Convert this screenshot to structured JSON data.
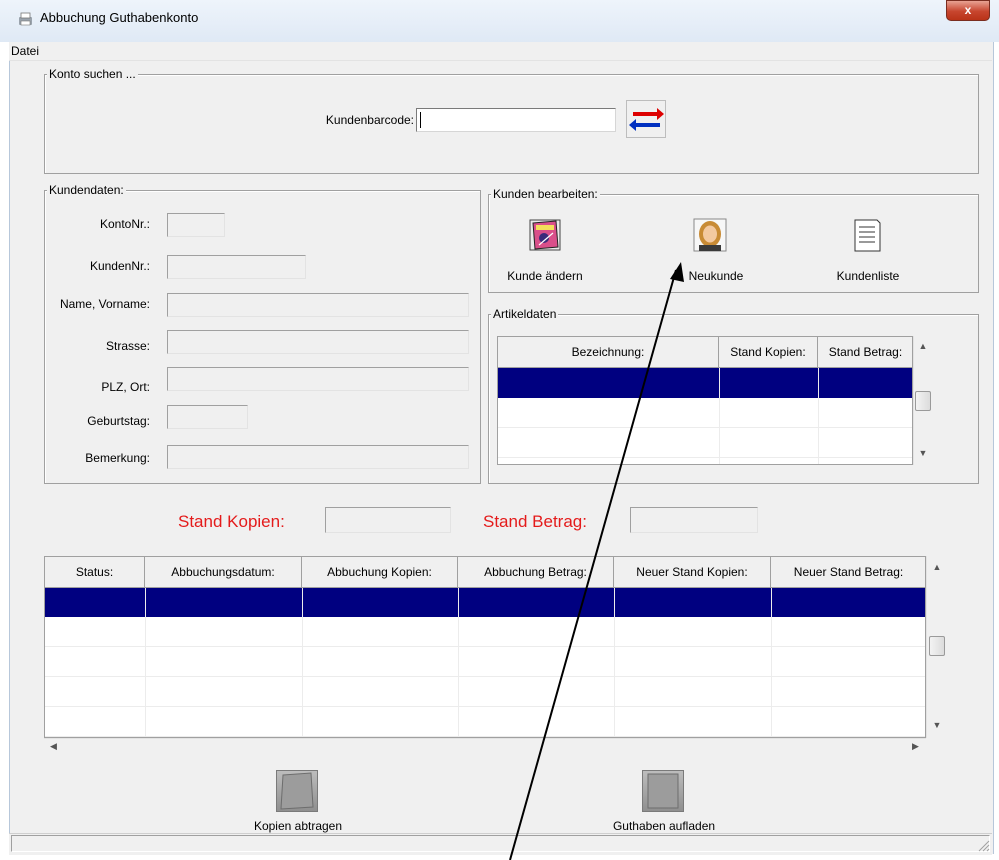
{
  "window": {
    "title": "Abbuchung Guthabenkonto",
    "close_label": "x"
  },
  "menu": {
    "datei": "Datei"
  },
  "search": {
    "group_label": "Konto suchen ...",
    "barcode_label": "Kundenbarcode:",
    "barcode_value": ""
  },
  "customer": {
    "group_label": "Kundendaten:",
    "konto_label": "KontoNr.:",
    "kunden_label": "KundenNr.:",
    "name_label": "Name, Vorname:",
    "strasse_label": "Strasse:",
    "plz_label": "PLZ, Ort:",
    "geburtstag_label": "Geburtstag:",
    "bemerkung_label": "Bemerkung:"
  },
  "edit": {
    "group_label": "Kunden bearbeiten:",
    "kunde_aendern": "Kunde ändern",
    "neukunde": "Neukunde",
    "kundenliste": "Kundenliste"
  },
  "articles": {
    "group_label": "Artikeldaten",
    "columns": [
      "Bezeichnung:",
      "Stand Kopien:",
      "Stand Betrag:"
    ]
  },
  "balances": {
    "kopien_label": "Stand Kopien:",
    "betrag_label": "Stand Betrag:"
  },
  "bookings": {
    "columns": [
      "Status:",
      "Abbuchungsdatum:",
      "Abbuchung Kopien:",
      "Abbuchung Betrag:",
      "Neuer Stand Kopien:",
      "Neuer Stand Betrag:"
    ]
  },
  "actions": {
    "kopien_abtragen": "Kopien abtragen",
    "guthaben_aufladen": "Guthaben aufladen"
  },
  "colors": {
    "selection": "#000080",
    "accent_red": "#e41b1b"
  }
}
